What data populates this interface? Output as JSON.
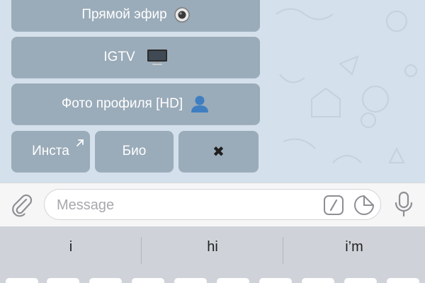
{
  "keyboard": {
    "live_label": "Прямой эфир",
    "live_icon": "radio-button-icon",
    "igtv_label": "IGTV",
    "igtv_icon": "desktop-computer-icon",
    "profile_photo_label": "Фото профиля [HD]",
    "profile_photo_icon": "bust-silhouette-icon",
    "insta_label": "Инста",
    "insta_icon": "north-east-arrow-icon",
    "bio_label": "Био",
    "close_label": "✖",
    "button_color": "#9aabb9"
  },
  "composer": {
    "message_placeholder": "Message",
    "attach_icon": "paperclip-icon",
    "commands_icon": "slash-command-icon",
    "sticker_icon": "sticker-icon",
    "mic_icon": "microphone-icon"
  },
  "suggestions": [
    "i",
    "hi",
    "i’m"
  ],
  "colors": {
    "chat_background": "#d4e0eb",
    "suggestion_bar": "#cfd3d9"
  }
}
